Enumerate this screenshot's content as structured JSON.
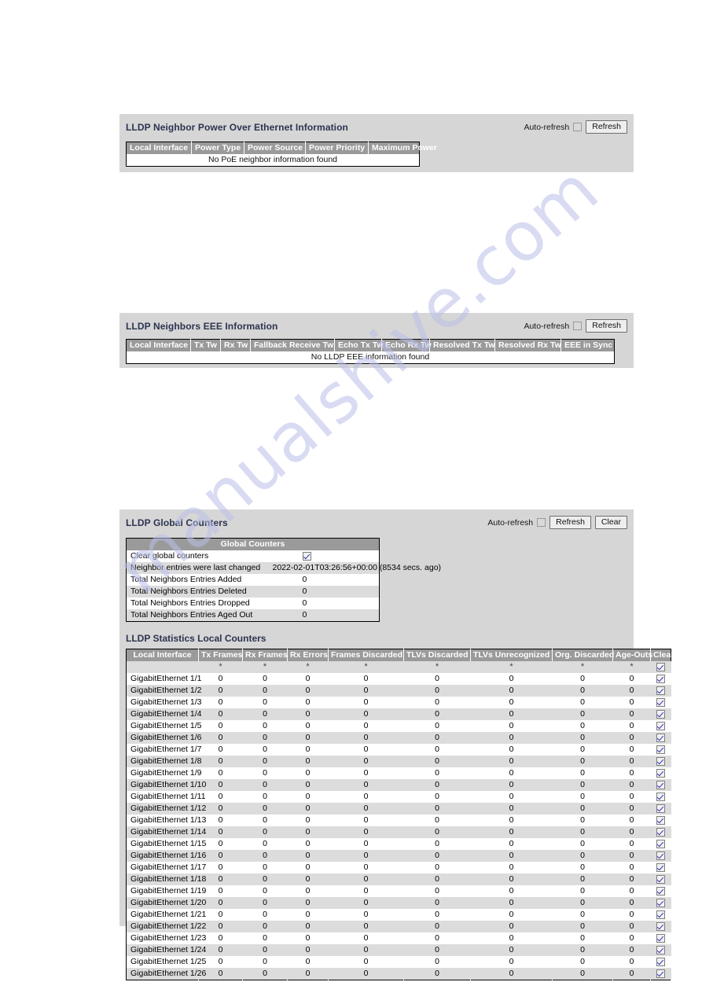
{
  "watermark": {
    "text": "manualshive.com"
  },
  "poe_section": {
    "title": "LLDP Neighbor Power Over Ethernet Information",
    "toolbar": {
      "auto_refresh_label": "Auto-refresh",
      "auto_refresh_checked": false,
      "refresh_label": "Refresh"
    },
    "columns": [
      "Local Interface",
      "Power Type",
      "Power Source",
      "Power Priority",
      "Maximum Power"
    ],
    "empty_message": "No PoE neighbor information found"
  },
  "eee_section": {
    "title": "LLDP Neighbors EEE Information",
    "toolbar": {
      "auto_refresh_label": "Auto-refresh",
      "auto_refresh_checked": false,
      "refresh_label": "Refresh"
    },
    "columns": [
      "Local Interface",
      "Tx Tw",
      "Rx Tw",
      "Fallback Receive Tw",
      "Echo Tx Tw",
      "Echo Rx Tw",
      "Resolved Tx Tw",
      "Resolved Rx Tw",
      "EEE in Sync"
    ],
    "empty_message": "No LLDP EEE information found"
  },
  "counters_section": {
    "title": "LLDP Global Counters",
    "toolbar": {
      "auto_refresh_label": "Auto-refresh",
      "auto_refresh_checked": false,
      "refresh_label": "Refresh",
      "clear_label": "Clear"
    },
    "global_counters": {
      "caption": "Global Counters",
      "rows": [
        {
          "label": "Clear global counters",
          "value": "",
          "type": "checkbox",
          "checked": true
        },
        {
          "label": "Neighbor entries were last changed",
          "value": "2022-02-01T03:26:56+00:00 (8534 secs. ago)",
          "type": "text"
        },
        {
          "label": "Total Neighbors Entries Added",
          "value": "0",
          "type": "num"
        },
        {
          "label": "Total Neighbors Entries Deleted",
          "value": "0",
          "type": "num"
        },
        {
          "label": "Total Neighbors Entries Dropped",
          "value": "0",
          "type": "num"
        },
        {
          "label": "Total Neighbors Entries Aged Out",
          "value": "0",
          "type": "num"
        }
      ]
    },
    "stats": {
      "title": "LLDP Statistics Local Counters",
      "columns": [
        "Local Interface",
        "Tx Frames",
        "Rx Frames",
        "Rx Errors",
        "Frames Discarded",
        "TLVs Discarded",
        "TLVs Unrecognized",
        "Org. Discarded",
        "Age-Outs",
        "Clear"
      ],
      "filter_row": [
        "",
        "*",
        "*",
        "*",
        "*",
        "*",
        "*",
        "*",
        "*",
        "checked"
      ],
      "rows": [
        {
          "interface": "GigabitEthernet 1/1",
          "values": [
            "0",
            "0",
            "0",
            "0",
            "0",
            "0",
            "0",
            "0"
          ],
          "clear": true
        },
        {
          "interface": "GigabitEthernet 1/2",
          "values": [
            "0",
            "0",
            "0",
            "0",
            "0",
            "0",
            "0",
            "0"
          ],
          "clear": true
        },
        {
          "interface": "GigabitEthernet 1/3",
          "values": [
            "0",
            "0",
            "0",
            "0",
            "0",
            "0",
            "0",
            "0"
          ],
          "clear": true
        },
        {
          "interface": "GigabitEthernet 1/4",
          "values": [
            "0",
            "0",
            "0",
            "0",
            "0",
            "0",
            "0",
            "0"
          ],
          "clear": true
        },
        {
          "interface": "GigabitEthernet 1/5",
          "values": [
            "0",
            "0",
            "0",
            "0",
            "0",
            "0",
            "0",
            "0"
          ],
          "clear": true
        },
        {
          "interface": "GigabitEthernet 1/6",
          "values": [
            "0",
            "0",
            "0",
            "0",
            "0",
            "0",
            "0",
            "0"
          ],
          "clear": true
        },
        {
          "interface": "GigabitEthernet 1/7",
          "values": [
            "0",
            "0",
            "0",
            "0",
            "0",
            "0",
            "0",
            "0"
          ],
          "clear": true
        },
        {
          "interface": "GigabitEthernet 1/8",
          "values": [
            "0",
            "0",
            "0",
            "0",
            "0",
            "0",
            "0",
            "0"
          ],
          "clear": true
        },
        {
          "interface": "GigabitEthernet 1/9",
          "values": [
            "0",
            "0",
            "0",
            "0",
            "0",
            "0",
            "0",
            "0"
          ],
          "clear": true
        },
        {
          "interface": "GigabitEthernet 1/10",
          "values": [
            "0",
            "0",
            "0",
            "0",
            "0",
            "0",
            "0",
            "0"
          ],
          "clear": true
        },
        {
          "interface": "GigabitEthernet 1/11",
          "values": [
            "0",
            "0",
            "0",
            "0",
            "0",
            "0",
            "0",
            "0"
          ],
          "clear": true
        },
        {
          "interface": "GigabitEthernet 1/12",
          "values": [
            "0",
            "0",
            "0",
            "0",
            "0",
            "0",
            "0",
            "0"
          ],
          "clear": true
        },
        {
          "interface": "GigabitEthernet 1/13",
          "values": [
            "0",
            "0",
            "0",
            "0",
            "0",
            "0",
            "0",
            "0"
          ],
          "clear": true
        },
        {
          "interface": "GigabitEthernet 1/14",
          "values": [
            "0",
            "0",
            "0",
            "0",
            "0",
            "0",
            "0",
            "0"
          ],
          "clear": true
        },
        {
          "interface": "GigabitEthernet 1/15",
          "values": [
            "0",
            "0",
            "0",
            "0",
            "0",
            "0",
            "0",
            "0"
          ],
          "clear": true
        },
        {
          "interface": "GigabitEthernet 1/16",
          "values": [
            "0",
            "0",
            "0",
            "0",
            "0",
            "0",
            "0",
            "0"
          ],
          "clear": true
        },
        {
          "interface": "GigabitEthernet 1/17",
          "values": [
            "0",
            "0",
            "0",
            "0",
            "0",
            "0",
            "0",
            "0"
          ],
          "clear": true
        },
        {
          "interface": "GigabitEthernet 1/18",
          "values": [
            "0",
            "0",
            "0",
            "0",
            "0",
            "0",
            "0",
            "0"
          ],
          "clear": true
        },
        {
          "interface": "GigabitEthernet 1/19",
          "values": [
            "0",
            "0",
            "0",
            "0",
            "0",
            "0",
            "0",
            "0"
          ],
          "clear": true
        },
        {
          "interface": "GigabitEthernet 1/20",
          "values": [
            "0",
            "0",
            "0",
            "0",
            "0",
            "0",
            "0",
            "0"
          ],
          "clear": true
        },
        {
          "interface": "GigabitEthernet 1/21",
          "values": [
            "0",
            "0",
            "0",
            "0",
            "0",
            "0",
            "0",
            "0"
          ],
          "clear": true
        },
        {
          "interface": "GigabitEthernet 1/22",
          "values": [
            "0",
            "0",
            "0",
            "0",
            "0",
            "0",
            "0",
            "0"
          ],
          "clear": true
        },
        {
          "interface": "GigabitEthernet 1/23",
          "values": [
            "0",
            "0",
            "0",
            "0",
            "0",
            "0",
            "0",
            "0"
          ],
          "clear": true
        },
        {
          "interface": "GigabitEthernet 1/24",
          "values": [
            "0",
            "0",
            "0",
            "0",
            "0",
            "0",
            "0",
            "0"
          ],
          "clear": true
        },
        {
          "interface": "GigabitEthernet 1/25",
          "values": [
            "0",
            "0",
            "0",
            "0",
            "0",
            "0",
            "0",
            "0"
          ],
          "clear": true
        },
        {
          "interface": "GigabitEthernet 1/26",
          "values": [
            "0",
            "0",
            "0",
            "0",
            "0",
            "0",
            "0",
            "0"
          ],
          "clear": true
        }
      ]
    }
  }
}
